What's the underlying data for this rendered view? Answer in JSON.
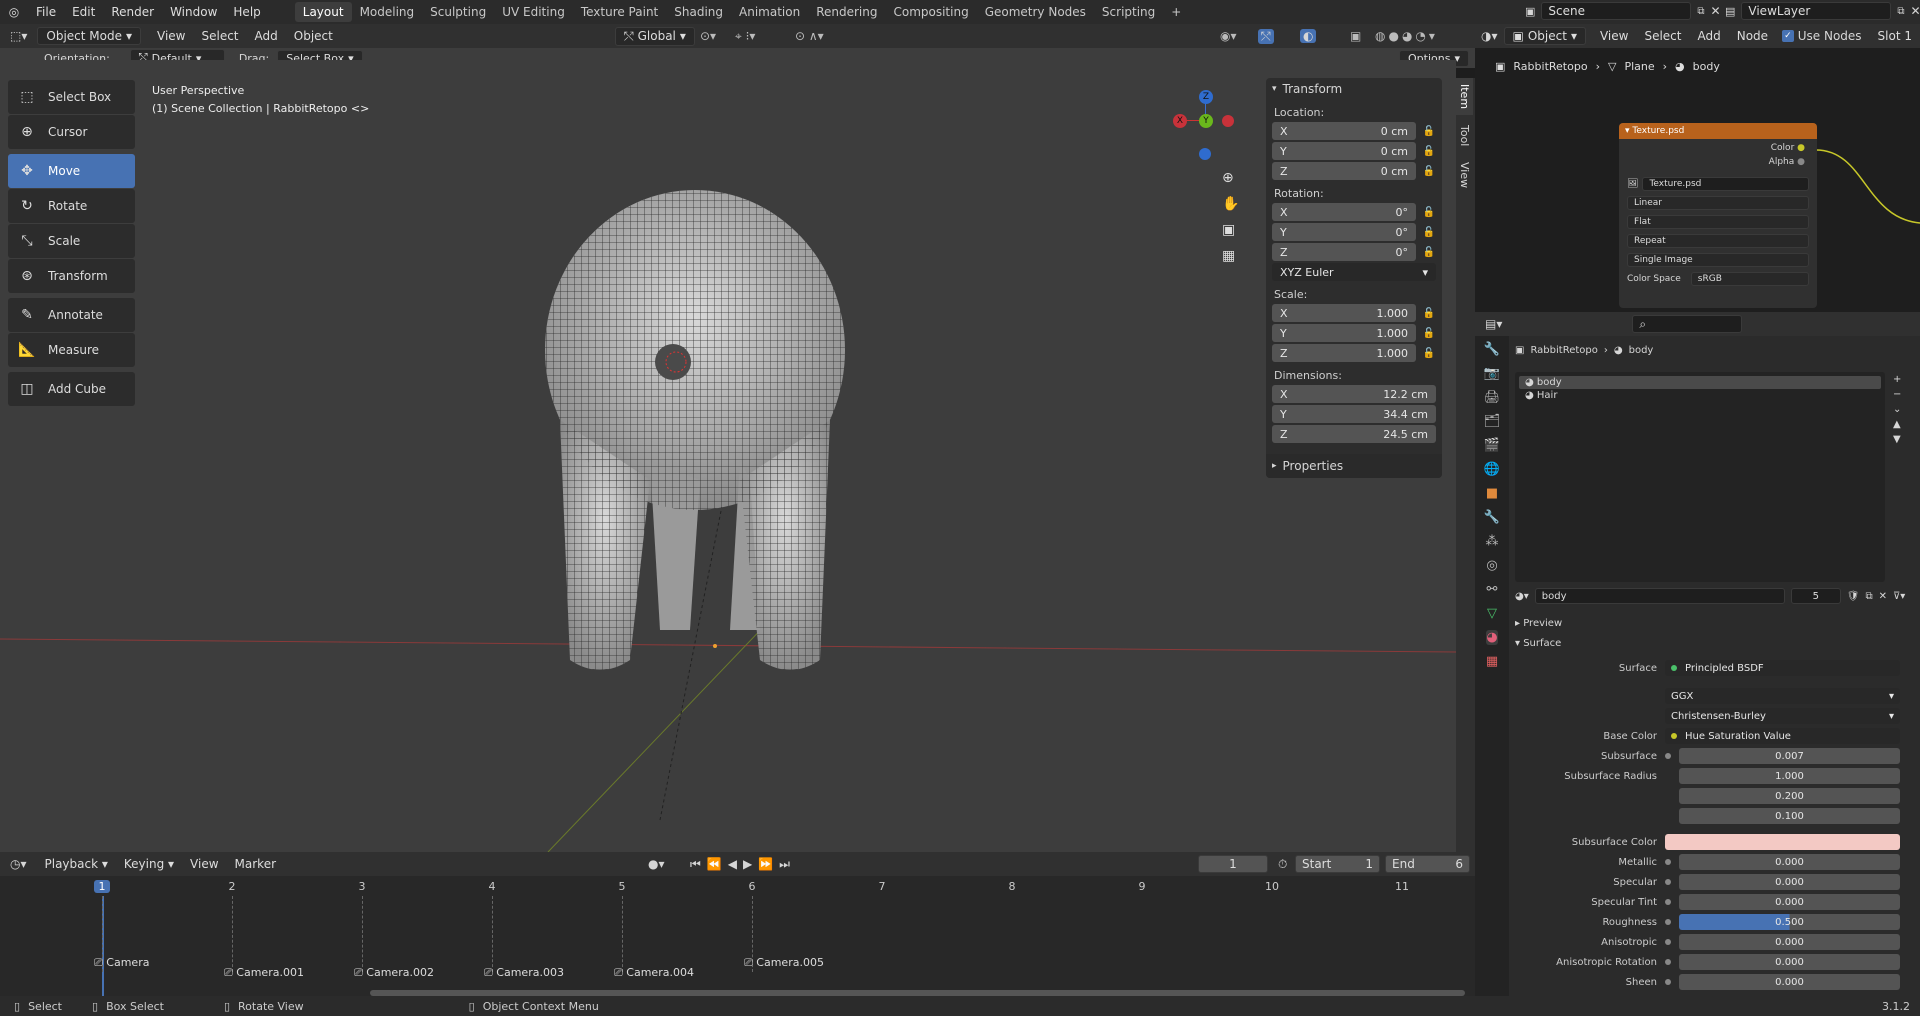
{
  "menu": [
    "File",
    "Edit",
    "Render",
    "Window",
    "Help"
  ],
  "workspaces": [
    "Layout",
    "Modeling",
    "Sculpting",
    "UV Editing",
    "Texture Paint",
    "Shading",
    "Animation",
    "Rendering",
    "Compositing",
    "Geometry Nodes",
    "Scripting"
  ],
  "active_workspace": "Layout",
  "scene": "Scene",
  "view_layer": "ViewLayer",
  "viewport_header": {
    "mode": "Object Mode",
    "menus": [
      "View",
      "Select",
      "Add",
      "Object"
    ],
    "transform": "Global"
  },
  "tool_settings": {
    "orientation_label": "Orientation:",
    "orientation": "Default",
    "drag_label": "Drag:",
    "drag": "Select Box",
    "options": "Options"
  },
  "viewport": {
    "perspective": "User Perspective",
    "collection": "(1) Scene Collection | RabbitRetopo <>"
  },
  "gizmo": {
    "x": "X",
    "y": "Y",
    "z": "Z"
  },
  "tools": [
    {
      "label": "Select Box"
    },
    {
      "label": "Cursor"
    },
    {
      "label": "Move"
    },
    {
      "label": "Rotate"
    },
    {
      "label": "Scale"
    },
    {
      "label": "Transform"
    },
    {
      "label": "Annotate"
    },
    {
      "label": "Measure"
    },
    {
      "label": "Add Cube"
    }
  ],
  "npanel": {
    "title": "Transform",
    "location_label": "Location:",
    "location": [
      {
        "axis": "X",
        "value": "0 cm"
      },
      {
        "axis": "Y",
        "value": "0 cm"
      },
      {
        "axis": "Z",
        "value": "0 cm"
      }
    ],
    "rotation_label": "Rotation:",
    "rotation": [
      {
        "axis": "X",
        "value": "0°"
      },
      {
        "axis": "Y",
        "value": "0°"
      },
      {
        "axis": "Z",
        "value": "0°"
      }
    ],
    "rotation_mode": "XYZ Euler",
    "scale_label": "Scale:",
    "scale": [
      {
        "axis": "X",
        "value": "1.000"
      },
      {
        "axis": "Y",
        "value": "1.000"
      },
      {
        "axis": "Z",
        "value": "1.000"
      }
    ],
    "dimensions_label": "Dimensions:",
    "dimensions": [
      {
        "axis": "X",
        "value": "12.2 cm"
      },
      {
        "axis": "Y",
        "value": "34.4 cm"
      },
      {
        "axis": "Z",
        "value": "24.5 cm"
      }
    ],
    "properties": "Properties",
    "tabs": [
      "Item",
      "Tool",
      "View"
    ]
  },
  "node_editor": {
    "header_type": "Object",
    "menus": [
      "View",
      "Select",
      "Add",
      "Node"
    ],
    "use_nodes": "Use Nodes",
    "slot": "Slot 1",
    "breadcrumb": [
      "RabbitRetopo",
      "Plane",
      "body"
    ],
    "node": {
      "title": "Texture.psd",
      "out_color": "Color",
      "out_alpha": "Alpha",
      "image": "Texture.psd",
      "interp": "Linear",
      "proj": "Flat",
      "ext": "Repeat",
      "source": "Single Image",
      "cs_label": "Color Space",
      "cs_value": "sRGB"
    }
  },
  "properties": {
    "breadcrumb": [
      "RabbitRetopo",
      "body"
    ],
    "slots": [
      "body",
      "Hair"
    ],
    "material_name": "body",
    "users": "5",
    "preview": "Preview",
    "surface_section": "Surface",
    "surface_label": "Surface",
    "surface_value": "Principled BSDF",
    "distribution": "GGX",
    "subsurface_method": "Christensen-Burley",
    "base_color_label": "Base Color",
    "base_color_value": "Hue Saturation Value",
    "rows": [
      {
        "label": "Subsurface",
        "value": "0.007"
      },
      {
        "label": "Subsurface Radius",
        "value": "1.000"
      },
      {
        "label": "",
        "value": "0.200"
      },
      {
        "label": "",
        "value": "0.100"
      }
    ],
    "subsurface_color_label": "Subsurface Color",
    "rows2": [
      {
        "label": "Metallic",
        "value": "0.000"
      },
      {
        "label": "Specular",
        "value": "0.000"
      },
      {
        "label": "Specular Tint",
        "value": "0.000"
      },
      {
        "label": "Roughness",
        "value": "0.500"
      },
      {
        "label": "Anisotropic",
        "value": "0.000"
      },
      {
        "label": "Anisotropic Rotation",
        "value": "0.000"
      },
      {
        "label": "Sheen",
        "value": "0.000"
      }
    ]
  },
  "timeline": {
    "menus": [
      "Playback",
      "Keying",
      "View",
      "Marker"
    ],
    "current_frame": "1",
    "start_label": "Start",
    "start": "1",
    "end_label": "End",
    "end": "6",
    "frames": [
      "1",
      "2",
      "3",
      "4",
      "5",
      "6",
      "7",
      "8",
      "9",
      "10",
      "11"
    ],
    "markers": [
      "Camera",
      "Camera.001",
      "Camera.002",
      "Camera.003",
      "Camera.004",
      "Camera.005"
    ]
  },
  "status": {
    "select": "Select",
    "box_select": "Box Select",
    "rotate_view": "Rotate View",
    "context_menu": "Object Context Menu",
    "version": "3.1.2"
  }
}
